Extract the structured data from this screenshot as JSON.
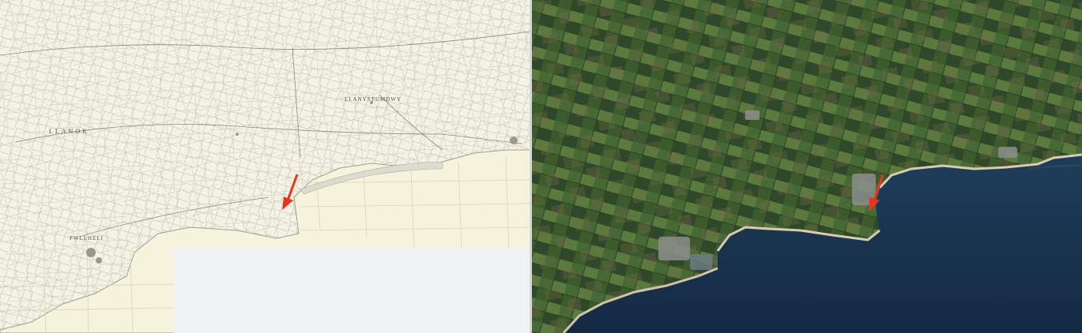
{
  "left_map": {
    "style": "historic-ordnance-survey",
    "labels": {
      "district": "LLANOR",
      "parish": "LLANYSTUMDWY",
      "town": "PWLLHELI"
    },
    "colors": {
      "paper": "#f4f2e4",
      "sea": "#f6f3dc",
      "uncovered": "#f1f2f5",
      "ink": "#8a8a80"
    }
  },
  "right_map": {
    "style": "satellite",
    "colors": {
      "land": "#3c5a2c",
      "sea": "#1a3450",
      "beach": "#d8ccb0"
    }
  },
  "marker": {
    "icon": "red-arrow-icon",
    "color": "#e8341c"
  }
}
